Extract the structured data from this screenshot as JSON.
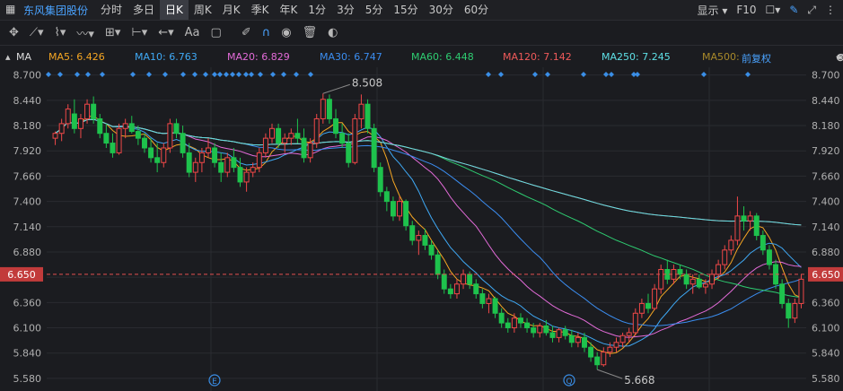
{
  "app": {
    "stock_name": "东风集团股份",
    "window_icon": "grid-icon"
  },
  "tabs": [
    {
      "label": "分时",
      "active": false
    },
    {
      "label": "多日",
      "active": false
    },
    {
      "label": "日K",
      "active": true
    },
    {
      "label": "周K",
      "active": false
    },
    {
      "label": "月K",
      "active": false
    },
    {
      "label": "季K",
      "active": false
    },
    {
      "label": "年K",
      "active": false
    },
    {
      "label": "1分",
      "active": false
    },
    {
      "label": "3分",
      "active": false
    },
    {
      "label": "5分",
      "active": false
    },
    {
      "label": "15分",
      "active": false
    },
    {
      "label": "30分",
      "active": false
    },
    {
      "label": "60分",
      "active": false
    }
  ],
  "topbar_right": {
    "display_label": "显示",
    "f10_label": "F10"
  },
  "toolbar": {
    "text_tool": "Aa"
  },
  "indicator": {
    "name": "MA",
    "restore_label": "前复权",
    "items": [
      {
        "label": "MA5: 6.426",
        "color": "#f5a623"
      },
      {
        "label": "MA10: 6.763",
        "color": "#3fa9f5"
      },
      {
        "label": "MA20: 6.829",
        "color": "#e36bd8"
      },
      {
        "label": "MA30: 6.747",
        "color": "#3b8df0"
      },
      {
        "label": "MA60: 6.448",
        "color": "#2ecc71"
      },
      {
        "label": "MA120: 7.142",
        "color": "#f05a5a"
      },
      {
        "label": "MA250: 7.245",
        "color": "#5ee0e6"
      },
      {
        "label": "MA500:",
        "color": "#a8892a"
      }
    ]
  },
  "colors": {
    "up": "#f04848",
    "down": "#1ec24d",
    "current_price": "#e45050",
    "marker": "#3a8ee6"
  },
  "chart_data": {
    "type": "candlestick",
    "ylim": [
      5.45,
      8.78
    ],
    "yticks": [
      "8.700",
      "8.440",
      "8.180",
      "7.920",
      "7.660",
      "7.400",
      "7.140",
      "6.880",
      "6.620",
      "6.360",
      "6.100",
      "5.840",
      "5.580"
    ],
    "current_price": "6.650",
    "high_annotation": "8.508",
    "low_annotation": "5.668",
    "event_markers": [
      "E",
      "Q"
    ],
    "ohlc": [
      [
        8.05,
        8.12,
        7.98,
        8.1
      ],
      [
        8.1,
        8.25,
        8.02,
        8.2
      ],
      [
        8.2,
        8.4,
        8.15,
        8.35
      ],
      [
        8.3,
        8.45,
        8.1,
        8.15
      ],
      [
        8.15,
        8.3,
        8.05,
        8.25
      ],
      [
        8.25,
        8.45,
        8.2,
        8.4
      ],
      [
        8.4,
        8.48,
        8.2,
        8.25
      ],
      [
        8.25,
        8.3,
        8.05,
        8.1
      ],
      [
        8.1,
        8.2,
        7.95,
        8.0
      ],
      [
        8.0,
        8.1,
        7.85,
        7.9
      ],
      [
        7.9,
        8.2,
        7.88,
        8.15
      ],
      [
        8.15,
        8.25,
        8.05,
        8.2
      ],
      [
        8.2,
        8.28,
        8.1,
        8.12
      ],
      [
        8.12,
        8.18,
        7.98,
        8.05
      ],
      [
        8.05,
        8.1,
        7.9,
        7.95
      ],
      [
        7.95,
        8.05,
        7.8,
        7.85
      ],
      [
        7.85,
        8.0,
        7.7,
        7.8
      ],
      [
        7.8,
        8.0,
        7.75,
        7.95
      ],
      [
        7.95,
        8.25,
        7.9,
        8.2
      ],
      [
        8.2,
        8.25,
        8.05,
        8.1
      ],
      [
        8.1,
        8.18,
        7.85,
        7.9
      ],
      [
        7.9,
        8.0,
        7.65,
        7.7
      ],
      [
        7.7,
        7.85,
        7.6,
        7.8
      ],
      [
        7.8,
        7.95,
        7.7,
        7.9
      ],
      [
        7.9,
        8.05,
        7.85,
        7.95
      ],
      [
        7.95,
        8.0,
        7.75,
        7.8
      ],
      [
        7.8,
        7.9,
        7.6,
        7.7
      ],
      [
        7.7,
        7.9,
        7.65,
        7.85
      ],
      [
        7.85,
        7.95,
        7.7,
        7.75
      ],
      [
        7.75,
        7.85,
        7.55,
        7.6
      ],
      [
        7.6,
        7.75,
        7.5,
        7.7
      ],
      [
        7.7,
        7.8,
        7.65,
        7.75
      ],
      [
        7.75,
        7.95,
        7.7,
        7.9
      ],
      [
        7.9,
        8.1,
        7.85,
        8.05
      ],
      [
        8.05,
        8.2,
        8.0,
        8.15
      ],
      [
        8.15,
        8.2,
        7.95,
        8.0
      ],
      [
        8.0,
        8.1,
        7.9,
        8.05
      ],
      [
        8.05,
        8.15,
        7.98,
        8.1
      ],
      [
        8.1,
        8.25,
        8.0,
        8.05
      ],
      [
        8.05,
        8.15,
        7.8,
        7.85
      ],
      [
        7.85,
        8.05,
        7.8,
        8.0
      ],
      [
        8.0,
        8.3,
        7.95,
        8.25
      ],
      [
        8.25,
        8.51,
        8.2,
        8.45
      ],
      [
        8.45,
        8.5,
        8.2,
        8.25
      ],
      [
        8.25,
        8.35,
        8.05,
        8.1
      ],
      [
        8.1,
        8.2,
        7.95,
        8.0
      ],
      [
        8.0,
        8.1,
        7.75,
        7.8
      ],
      [
        7.8,
        8.3,
        7.78,
        8.25
      ],
      [
        8.25,
        8.5,
        8.15,
        8.4
      ],
      [
        8.4,
        8.45,
        8.1,
        8.15
      ],
      [
        8.15,
        8.2,
        7.7,
        7.75
      ],
      [
        7.75,
        7.8,
        7.45,
        7.5
      ],
      [
        7.5,
        7.55,
        7.3,
        7.4
      ],
      [
        7.4,
        7.45,
        7.2,
        7.25
      ],
      [
        7.25,
        7.45,
        7.2,
        7.4
      ],
      [
        7.4,
        7.42,
        7.1,
        7.15
      ],
      [
        7.15,
        7.2,
        6.95,
        7.0
      ],
      [
        7.0,
        7.1,
        6.85,
        7.05
      ],
      [
        7.05,
        7.12,
        6.9,
        6.95
      ],
      [
        6.95,
        7.0,
        6.8,
        6.85
      ],
      [
        6.85,
        6.9,
        6.6,
        6.65
      ],
      [
        6.65,
        6.7,
        6.45,
        6.5
      ],
      [
        6.5,
        6.55,
        6.4,
        6.45
      ],
      [
        6.45,
        6.6,
        6.4,
        6.55
      ],
      [
        6.55,
        6.7,
        6.5,
        6.65
      ],
      [
        6.65,
        6.68,
        6.5,
        6.55
      ],
      [
        6.55,
        6.6,
        6.4,
        6.45
      ],
      [
        6.45,
        6.5,
        6.3,
        6.35
      ],
      [
        6.35,
        6.45,
        6.25,
        6.4
      ],
      [
        6.4,
        6.42,
        6.2,
        6.25
      ],
      [
        6.25,
        6.3,
        6.1,
        6.15
      ],
      [
        6.15,
        6.2,
        6.05,
        6.1
      ],
      [
        6.1,
        6.25,
        6.05,
        6.2
      ],
      [
        6.2,
        6.25,
        6.1,
        6.15
      ],
      [
        6.15,
        6.2,
        6.05,
        6.1
      ],
      [
        6.1,
        6.15,
        6.0,
        6.05
      ],
      [
        6.05,
        6.15,
        6.0,
        6.12
      ],
      [
        6.12,
        6.18,
        6.02,
        6.05
      ],
      [
        6.05,
        6.12,
        5.95,
        6.0
      ],
      [
        6.0,
        6.1,
        5.95,
        6.08
      ],
      [
        6.08,
        6.12,
        5.98,
        6.02
      ],
      [
        6.02,
        6.08,
        5.9,
        5.95
      ],
      [
        5.95,
        6.05,
        5.9,
        6.0
      ],
      [
        6.0,
        6.05,
        5.85,
        5.9
      ],
      [
        5.9,
        5.95,
        5.75,
        5.8
      ],
      [
        5.8,
        5.85,
        5.67,
        5.72
      ],
      [
        5.72,
        5.9,
        5.7,
        5.85
      ],
      [
        5.85,
        5.95,
        5.8,
        5.9
      ],
      [
        5.9,
        6.0,
        5.85,
        5.95
      ],
      [
        5.95,
        6.05,
        5.9,
        6.02
      ],
      [
        6.02,
        6.1,
        5.95,
        6.05
      ],
      [
        6.05,
        6.3,
        6.02,
        6.25
      ],
      [
        6.25,
        6.4,
        6.2,
        6.35
      ],
      [
        6.35,
        6.45,
        6.25,
        6.3
      ],
      [
        6.3,
        6.55,
        6.28,
        6.5
      ],
      [
        6.5,
        6.75,
        6.45,
        6.7
      ],
      [
        6.7,
        6.8,
        6.55,
        6.6
      ],
      [
        6.6,
        6.75,
        6.55,
        6.7
      ],
      [
        6.7,
        6.75,
        6.6,
        6.65
      ],
      [
        6.65,
        6.7,
        6.5,
        6.55
      ],
      [
        6.55,
        6.65,
        6.45,
        6.6
      ],
      [
        6.6,
        6.65,
        6.5,
        6.52
      ],
      [
        6.52,
        6.6,
        6.45,
        6.55
      ],
      [
        6.55,
        6.7,
        6.5,
        6.65
      ],
      [
        6.65,
        6.8,
        6.6,
        6.75
      ],
      [
        6.75,
        6.95,
        6.7,
        6.9
      ],
      [
        6.9,
        7.05,
        6.85,
        7.0
      ],
      [
        7.0,
        7.45,
        6.95,
        7.25
      ],
      [
        7.25,
        7.35,
        7.1,
        7.2
      ],
      [
        7.2,
        7.3,
        7.1,
        7.25
      ],
      [
        7.25,
        7.28,
        7.0,
        7.05
      ],
      [
        7.05,
        7.1,
        6.85,
        6.9
      ],
      [
        6.9,
        6.95,
        6.7,
        6.75
      ],
      [
        6.75,
        6.8,
        6.5,
        6.55
      ],
      [
        6.55,
        6.6,
        6.3,
        6.35
      ],
      [
        6.35,
        6.4,
        6.1,
        6.2
      ],
      [
        6.2,
        6.4,
        6.15,
        6.35
      ],
      [
        6.35,
        6.65,
        6.3,
        6.6
      ]
    ]
  }
}
